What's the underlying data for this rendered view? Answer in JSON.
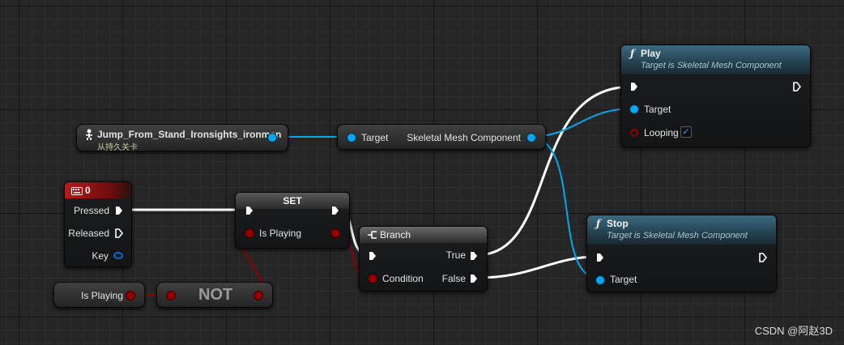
{
  "colors": {
    "background": "#262626",
    "exec_wire": "#ffffff",
    "object_wire": "#00a8f3",
    "bool_wire": "#930000",
    "function_header": "#34586c",
    "event_header": "#a31515"
  },
  "animation_node": {
    "title": "Jump_From_Stand_Ironsights_ironman",
    "subtitle": "从持久关卡",
    "icon": "skeleton-icon"
  },
  "get_mesh_node": {
    "input_label": "Target",
    "output_label": "Skeletal Mesh Component"
  },
  "key_event": {
    "title": "0",
    "icon": "keyboard-icon",
    "pins": [
      "Pressed",
      "Released",
      "Key"
    ]
  },
  "set_node": {
    "title": "SET",
    "var_label": "Is Playing"
  },
  "get_var_node": {
    "label": "Is Playing"
  },
  "not_node": {
    "label": "NOT"
  },
  "branch_node": {
    "title": "Branch",
    "icon": "branch-icon",
    "condition_label": "Condition",
    "true_label": "True",
    "false_label": "False"
  },
  "play_node": {
    "title": "Play",
    "icon_glyph": "ƒ",
    "subtitle": "Target is Skeletal Mesh Component",
    "target_label": "Target",
    "looping_label": "Looping",
    "looping_checked": true,
    "check_glyph": "✓"
  },
  "stop_node": {
    "title": "Stop",
    "icon_glyph": "ƒ",
    "subtitle": "Target is Skeletal Mesh Component",
    "target_label": "Target"
  },
  "watermark": "CSDN @阿赵3D"
}
